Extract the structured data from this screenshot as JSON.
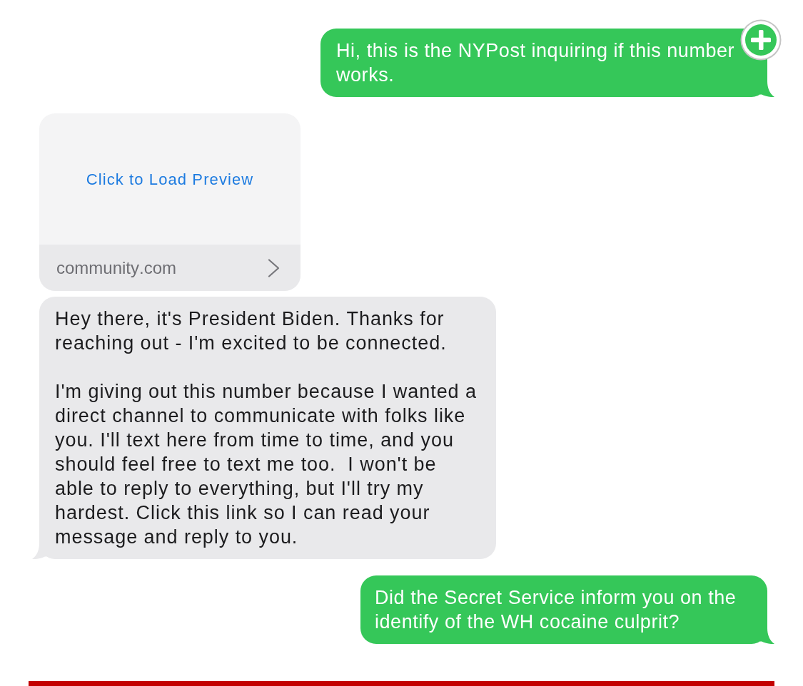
{
  "messages": [
    {
      "kind": "text",
      "outgoing": true,
      "plus_badge": true,
      "text": "Hi, this is the NYPost inquiring if this number works."
    },
    {
      "kind": "link_preview",
      "outgoing": false,
      "plus_badge": false,
      "link_text": "Click to Load Preview",
      "domain": "community.com"
    },
    {
      "kind": "text",
      "outgoing": false,
      "plus_badge": false,
      "text": "Hey there, it's President Biden. Thanks for reaching out - I'm excited to be connected.\n\nI'm giving out this number because I wanted a direct channel to communicate with folks like you. I'll text here from time to time, and you should feel free to text me too.  I won't be able to reply to everything, but I'll try my hardest. Click this link so I can read your message and reply to you."
    },
    {
      "kind": "text",
      "outgoing": true,
      "plus_badge": false,
      "text": "Did the Secret Service inform you on the identify of the WH cocaine culprit?"
    }
  ]
}
